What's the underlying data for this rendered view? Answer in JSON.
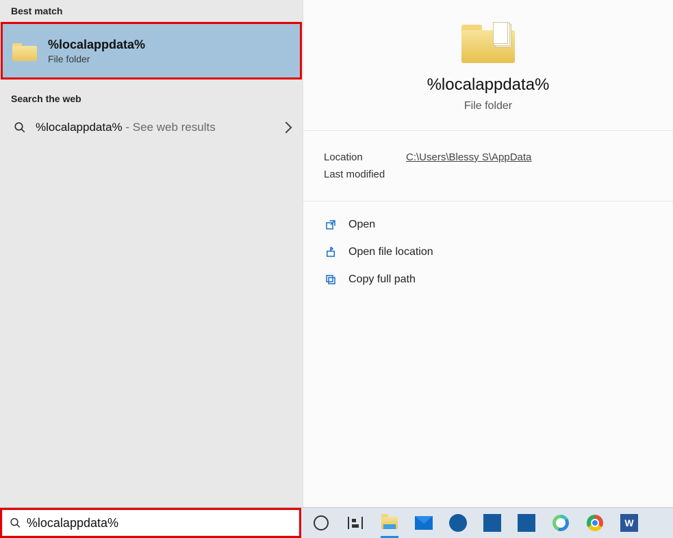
{
  "left": {
    "best_match_label": "Best match",
    "best_match": {
      "title": "%localappdata%",
      "subtitle": "File folder"
    },
    "web_label": "Search the web",
    "web_item": {
      "query": "%localappdata%",
      "suffix": " - See web results"
    }
  },
  "right": {
    "title": "%localappdata%",
    "subtitle": "File folder",
    "meta": {
      "location_key": "Location",
      "location_val": "C:\\Users\\Blessy S\\AppData",
      "modified_key": "Last modified",
      "modified_val": ""
    },
    "actions": {
      "open": "Open",
      "open_loc": "Open file location",
      "copy_path": "Copy full path"
    }
  },
  "searchbox": {
    "value": "%localappdata%"
  },
  "taskbar": {
    "word_letter": "W"
  }
}
